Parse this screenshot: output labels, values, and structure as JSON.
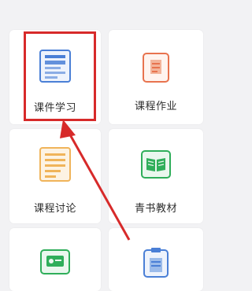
{
  "tiles": [
    {
      "label": "课件学习",
      "icon": "courseware-icon",
      "color": "#4a7fd6"
    },
    {
      "label": "课程作业",
      "icon": "homework-icon",
      "color": "#e8734e"
    },
    {
      "label": "课程讨论",
      "icon": "discussion-icon",
      "color": "#f0b45a"
    },
    {
      "label": "青书教材",
      "icon": "textbook-icon",
      "color": "#2fae5a"
    },
    {
      "label": "",
      "icon": "card-icon",
      "color": "#2fae5a"
    },
    {
      "label": "",
      "icon": "clipboard-icon",
      "color": "#4a7fd6"
    }
  ],
  "annotation": {
    "highlight_color": "#d72a2a"
  }
}
